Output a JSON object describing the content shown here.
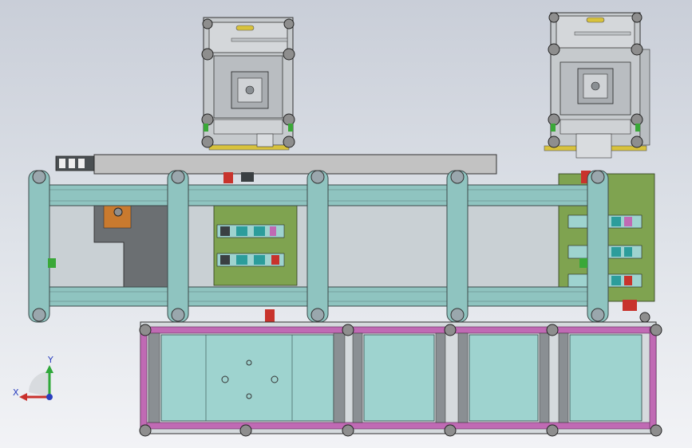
{
  "viewport": {
    "background_top": "#c9ced8",
    "background_bottom": "#f2f3f6"
  },
  "colors": {
    "frame_teal": "#8fc4c0",
    "frame_edge": "#3c4a4a",
    "pillar_grey": "#9aa7ad",
    "rail_grey": "#b9c2c8",
    "panel_green": "#7fa350",
    "panel_pink": "#c06ab4",
    "plate_cyan": "#9ed3cf",
    "dark_grey": "#6b6f72",
    "roller_grey": "#8e8e8e",
    "accent_red": "#c8332c",
    "accent_yellow": "#d8c23c",
    "accent_green": "#3aa838"
  },
  "triad": {
    "x_label": "X",
    "y_label": "Y",
    "x_color": "#c9302c",
    "y_color": "#2fa83a",
    "z_color": "#2a3fbf",
    "icon": "coordinate-triad-icon"
  }
}
